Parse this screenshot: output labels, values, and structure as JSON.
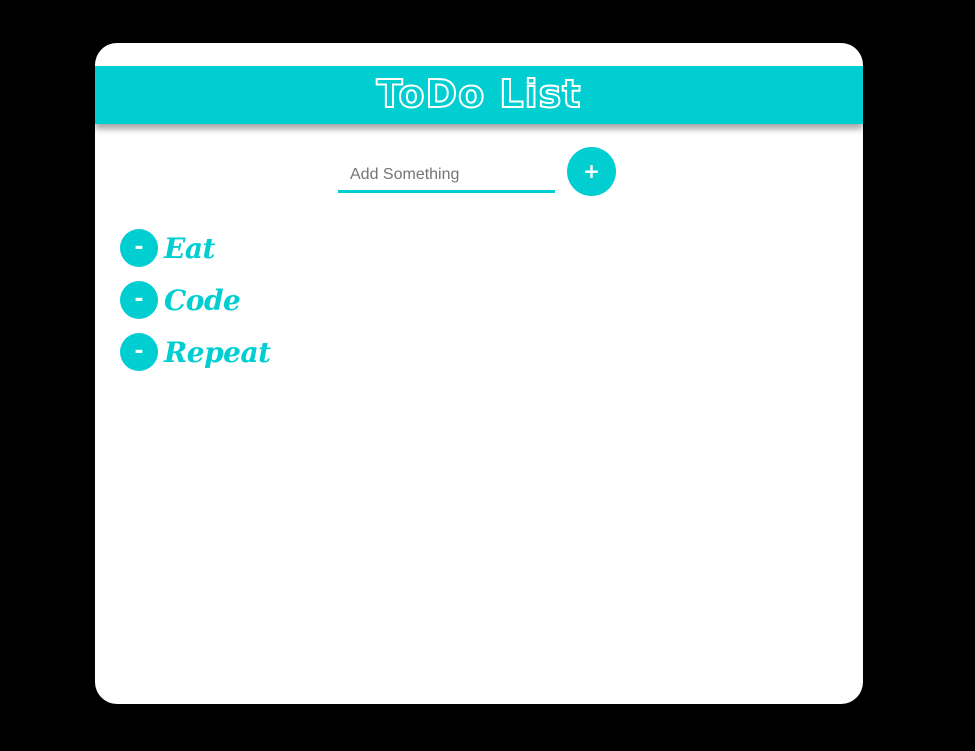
{
  "app": {
    "title": "ToDo List"
  },
  "add_form": {
    "placeholder": "Add Something",
    "value": "",
    "add_label": "+"
  },
  "todos": [
    {
      "text": "Eat",
      "remove_label": "-"
    },
    {
      "text": "Code",
      "remove_label": "-"
    },
    {
      "text": "Repeat",
      "remove_label": "-"
    }
  ],
  "colors": {
    "accent": "#00ced1",
    "background": "#000000",
    "card": "#ffffff"
  }
}
